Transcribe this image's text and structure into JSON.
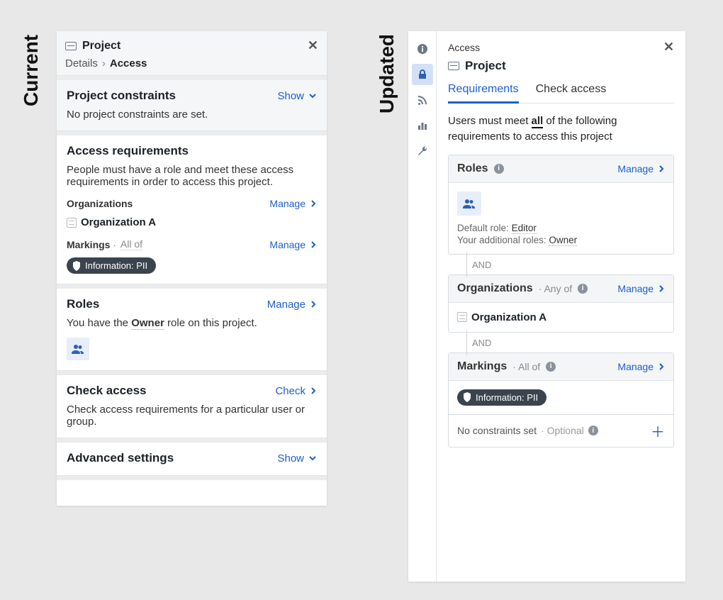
{
  "labels": {
    "current": "Current",
    "updated": "Updated"
  },
  "current": {
    "header": {
      "title": "Project",
      "crumb_details": "Details",
      "crumb_access": "Access"
    },
    "constraints": {
      "title": "Project constraints",
      "action": "Show",
      "desc": "No project constraints are set."
    },
    "access_req": {
      "title": "Access requirements",
      "desc": "People must have a role and meet these access requirements in order to access this project.",
      "organizations_label": "Organizations",
      "manage": "Manage",
      "org_name": "Organization A",
      "markings_label": "Markings",
      "markings_mode": "All of",
      "marking_pill": "Information: PII"
    },
    "roles": {
      "title": "Roles",
      "manage": "Manage",
      "desc_pre": "You have the ",
      "desc_role": "Owner",
      "desc_post": " role on this project."
    },
    "check": {
      "title": "Check access",
      "action": "Check",
      "desc": "Check access requirements for a particular user or group."
    },
    "advanced": {
      "title": "Advanced settings",
      "action": "Show"
    }
  },
  "updated": {
    "top": {
      "access": "Access",
      "title": "Project"
    },
    "tabs": {
      "requirements": "Requirements",
      "check": "Check access"
    },
    "lead_pre": "Users must meet ",
    "lead_emph": "all",
    "lead_post": " of the following requirements to access this project",
    "roles": {
      "title": "Roles",
      "manage": "Manage",
      "default_label": "Default role:",
      "default_value": "Editor",
      "your_label": "Your additional roles:",
      "your_value": "Owner"
    },
    "and": "AND",
    "orgs": {
      "title": "Organizations",
      "mode": "Any of",
      "manage": "Manage",
      "name": "Organization A"
    },
    "markings": {
      "title": "Markings",
      "mode": "All of",
      "manage": "Manage",
      "pill": "Information: PII"
    },
    "constraints": {
      "text": "No constraints set",
      "optional": "Optional"
    }
  }
}
